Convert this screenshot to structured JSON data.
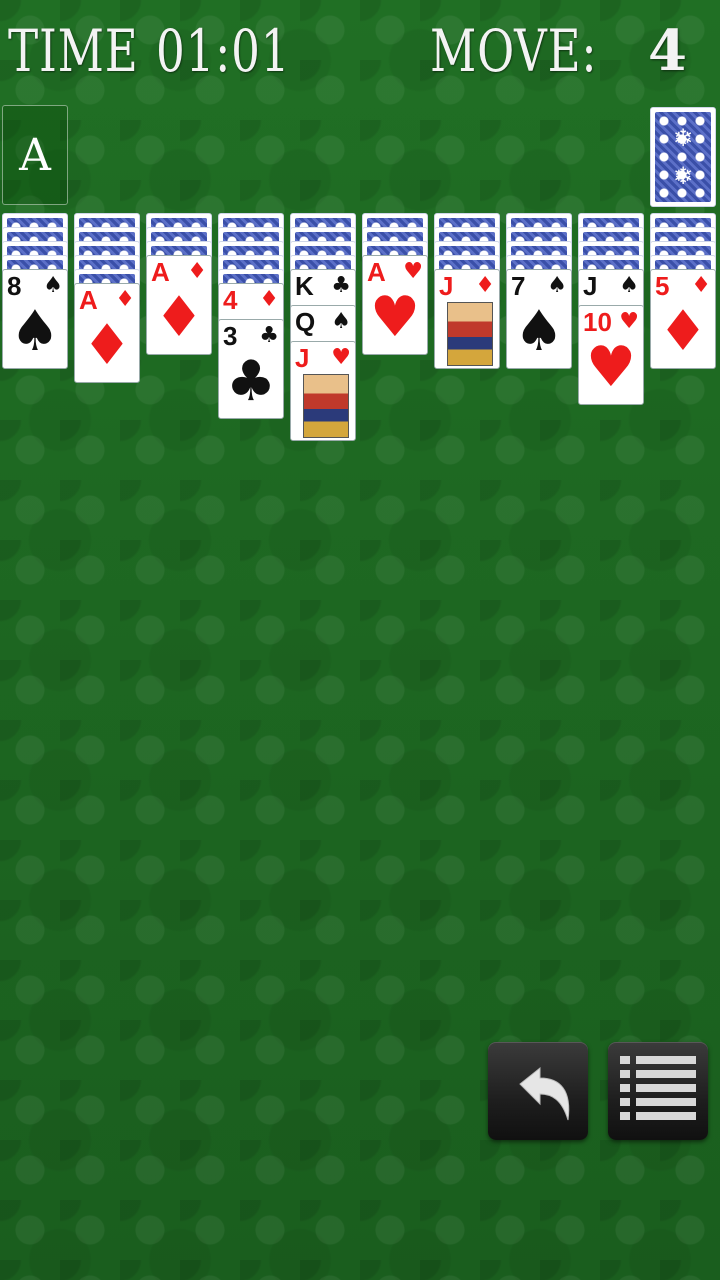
{
  "hud": {
    "time_label": "TIME",
    "time_value": "01:01",
    "move_label": "MOVE:",
    "move_value": "4"
  },
  "foundation": {
    "label": "A"
  },
  "columns": [
    {
      "hidden": 4,
      "cards": [
        {
          "rank": "8",
          "suit": "♠",
          "color": "black"
        }
      ]
    },
    {
      "hidden": 5,
      "cards": [
        {
          "rank": "A",
          "suit": "♦",
          "color": "red"
        }
      ]
    },
    {
      "hidden": 3,
      "cards": [
        {
          "rank": "A",
          "suit": "♦",
          "color": "red"
        }
      ]
    },
    {
      "hidden": 5,
      "cards": [
        {
          "rank": "4",
          "suit": "♦",
          "color": "red"
        },
        {
          "rank": "3",
          "suit": "♣",
          "color": "black"
        }
      ]
    },
    {
      "hidden": 4,
      "cards": [
        {
          "rank": "K",
          "suit": "♣",
          "color": "black"
        },
        {
          "rank": "Q",
          "suit": "♠",
          "color": "black"
        },
        {
          "rank": "J",
          "suit": "♥",
          "color": "red",
          "face": true
        }
      ]
    },
    {
      "hidden": 3,
      "cards": [
        {
          "rank": "A",
          "suit": "♥",
          "color": "red"
        }
      ]
    },
    {
      "hidden": 4,
      "cards": [
        {
          "rank": "J",
          "suit": "♦",
          "color": "red",
          "face": true
        }
      ]
    },
    {
      "hidden": 4,
      "cards": [
        {
          "rank": "7",
          "suit": "♠",
          "color": "black"
        }
      ]
    },
    {
      "hidden": 4,
      "cards": [
        {
          "rank": "J",
          "suit": "♠",
          "color": "black"
        },
        {
          "rank": "10",
          "suit": "♥",
          "color": "red"
        }
      ]
    },
    {
      "hidden": 4,
      "cards": [
        {
          "rank": "5",
          "suit": "♦",
          "color": "red"
        }
      ]
    }
  ],
  "buttons": {
    "undo_icon": "undo-arrow-icon",
    "menu_icon": "menu-list-icon"
  }
}
